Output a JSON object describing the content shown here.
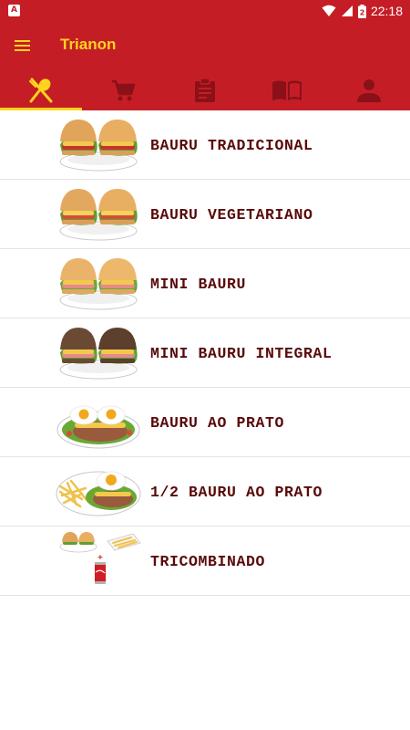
{
  "status_bar": {
    "time": "22:18",
    "app_icon_letter": "A",
    "battery_level": "2"
  },
  "toolbar": {
    "title": "Trianon",
    "menu_icon": "hamburger-menu-icon"
  },
  "tabs": [
    {
      "icon": "utensils-icon",
      "active": true
    },
    {
      "icon": "cart-icon",
      "active": false
    },
    {
      "icon": "clipboard-icon",
      "active": false
    },
    {
      "icon": "book-icon",
      "active": false
    },
    {
      "icon": "person-icon",
      "active": false
    }
  ],
  "menu": {
    "items": [
      {
        "label": "BAURU TRADICIONAL",
        "image": "sandwich-pair"
      },
      {
        "label": "BAURU VEGETARIANO",
        "image": "sandwich-pair"
      },
      {
        "label": "MINI BAURU",
        "image": "sandwich-pair"
      },
      {
        "label": "MINI BAURU INTEGRAL",
        "image": "whole-wheat-sandwich-pair"
      },
      {
        "label": "BAURU AO PRATO",
        "image": "plate-with-eggs"
      },
      {
        "label": "1/2 BAURU AO PRATO",
        "image": "plate-with-egg-and-fries"
      },
      {
        "label": "TRICOMBINADO",
        "image": "combo-sandwich-fries-soda"
      }
    ]
  },
  "colors": {
    "primary": "#c51d26",
    "accent": "#ffd41f",
    "label_text": "#5a0a0a",
    "divider": "#e3e3e3"
  }
}
